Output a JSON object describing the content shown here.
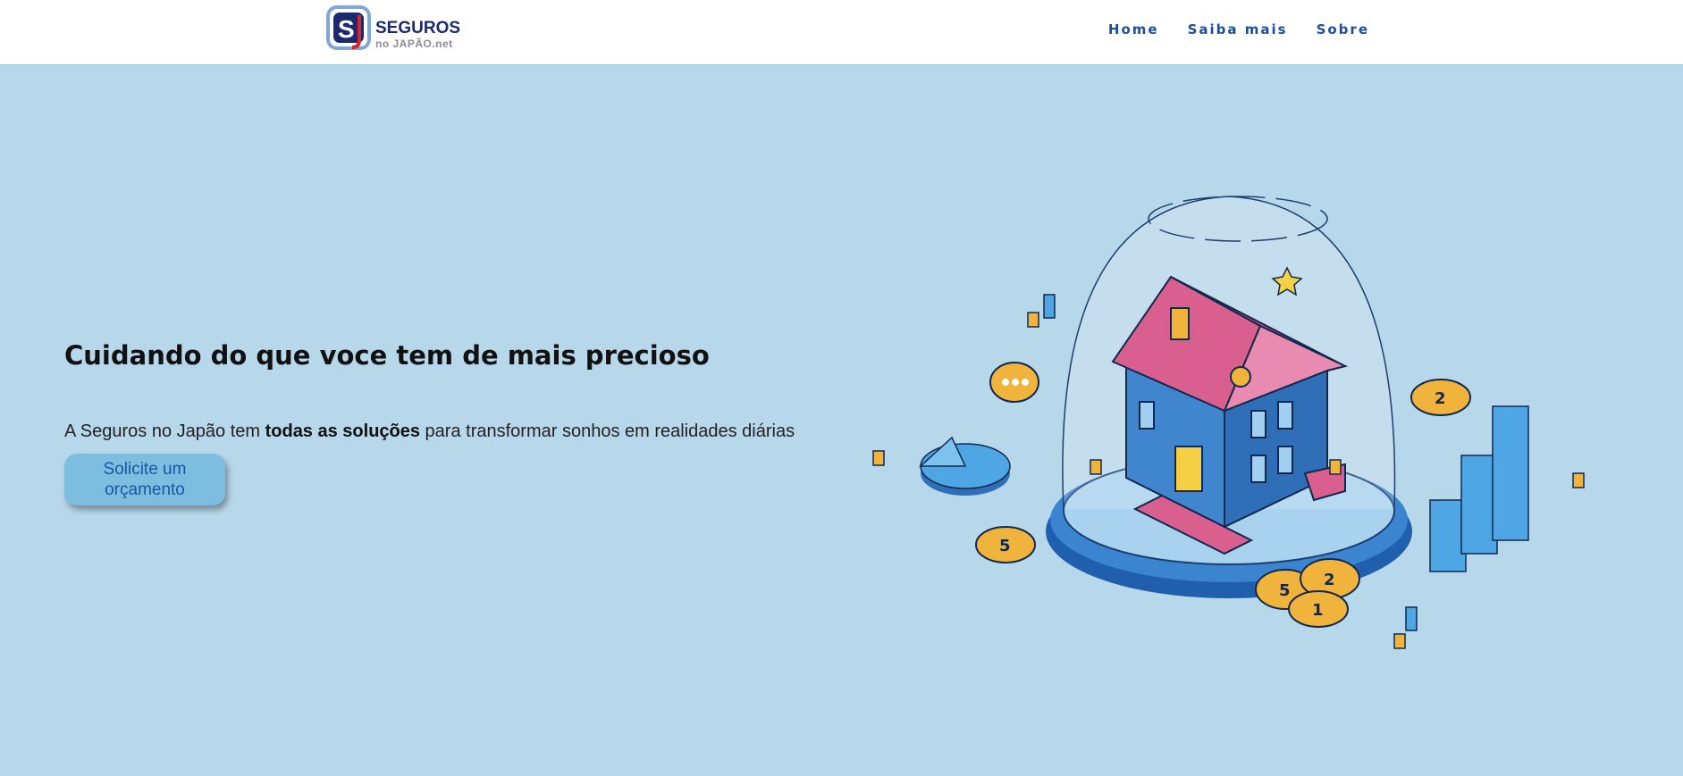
{
  "header": {
    "logo": {
      "word": "SEGUROS",
      "sub": "no JAPÃO.net",
      "mark_letters": "SJ"
    },
    "nav": [
      {
        "label": "Home"
      },
      {
        "label": "Saiba mais"
      },
      {
        "label": "Sobre"
      }
    ]
  },
  "hero": {
    "title": "Cuidando do que voce tem de mais precioso",
    "subtitle_before": "A Seguros no Japão tem ",
    "subtitle_bold": "todas as soluções",
    "subtitle_after": " para transformar sonhos em realidades diárias",
    "cta_label": "Solicite um orçamento"
  },
  "illustration": {
    "coins": [
      "5",
      "2",
      "5",
      "2",
      "1"
    ]
  },
  "colors": {
    "background": "#b7d7ea",
    "header_bg": "#ffffff",
    "nav_text": "#1b4f9c",
    "cta_bg": "#7cbde0",
    "cta_text": "#1a56a3",
    "roof": "#d9608e",
    "house_blue": "#3f86cf",
    "coin_gold": "#f0b33c"
  }
}
